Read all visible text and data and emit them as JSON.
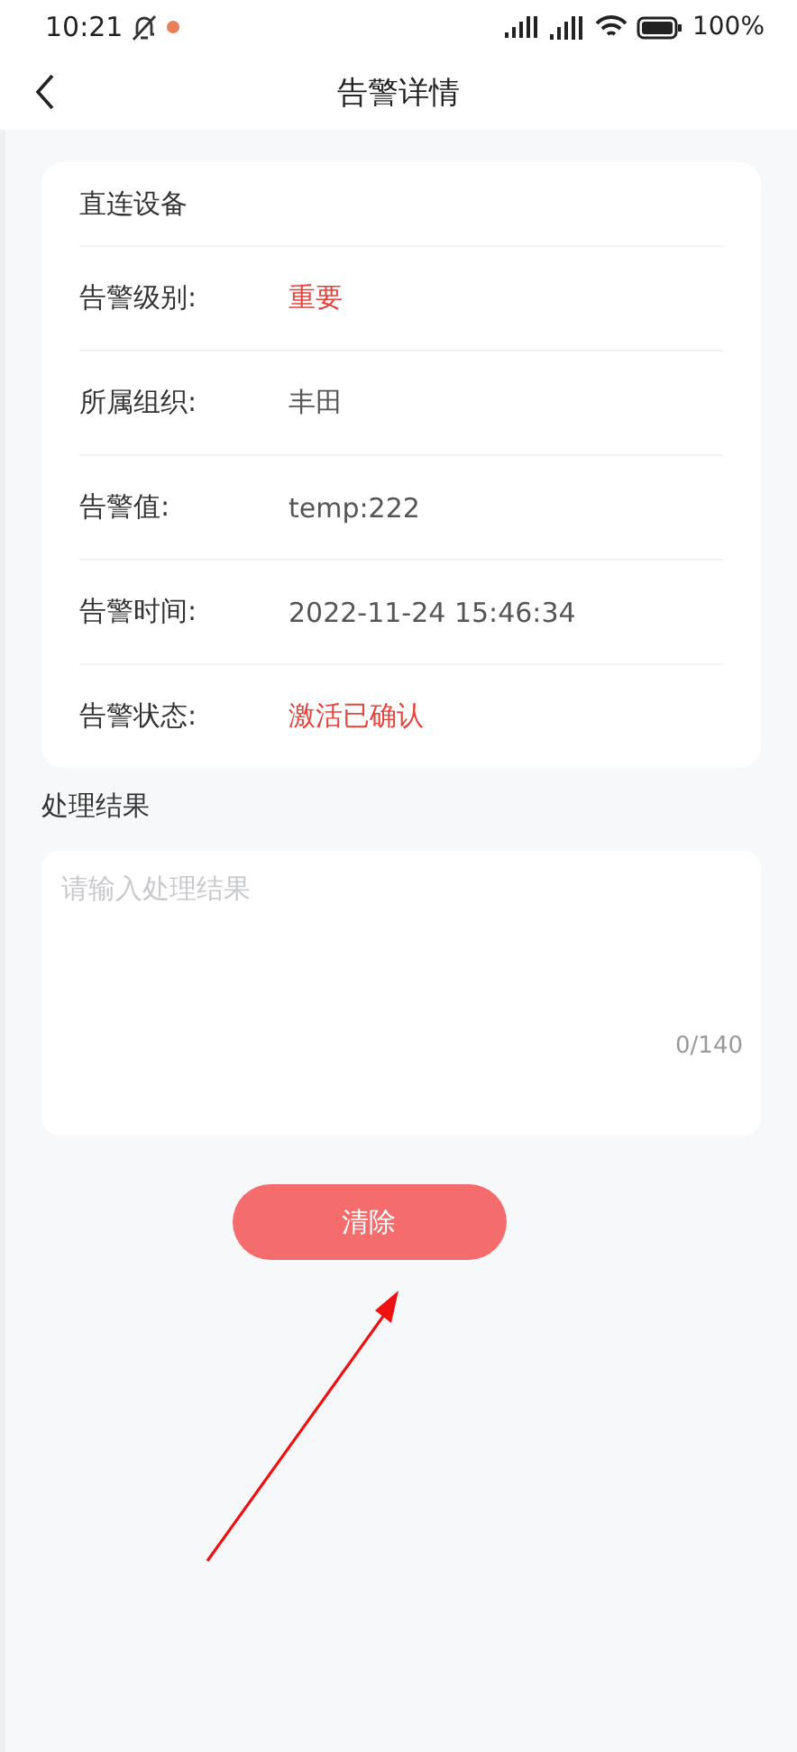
{
  "status_bar": {
    "time": "10:21",
    "battery": "100%"
  },
  "header": {
    "title": "告警详情"
  },
  "card": {
    "title": "直连设备",
    "rows": [
      {
        "label": "告警级别:",
        "value": "重要",
        "color": "#e5443d"
      },
      {
        "label": "所属组织:",
        "value": "丰田",
        "color": "#555555"
      },
      {
        "label": "告警值:",
        "value": "temp:222",
        "color": "#555555"
      },
      {
        "label": "告警时间:",
        "value": "2022-11-24 15:46:34",
        "color": "#555555"
      },
      {
        "label": "告警状态:",
        "value": "激活已确认",
        "color": "#e5443d"
      }
    ]
  },
  "result": {
    "title": "处理结果",
    "placeholder": "请输入处理结果",
    "counter": "0/140"
  },
  "buttons": [
    "清除"
  ]
}
